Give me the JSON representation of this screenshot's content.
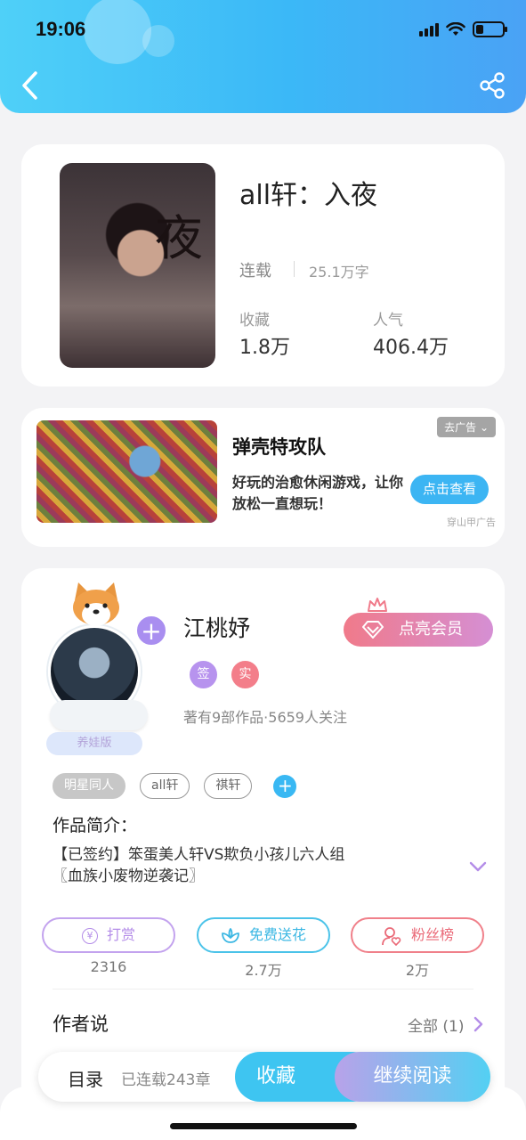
{
  "status_bar": {
    "time": "19:06",
    "battery_percent": 20
  },
  "header": {
    "back_icon": "chevron-left-icon",
    "share_icon": "share-icon"
  },
  "book": {
    "title": "all轩：入夜",
    "status": "连载",
    "word_count": "25.1万字",
    "favorites_label": "收藏",
    "favorites_value": "1.8万",
    "popularity_label": "人气",
    "popularity_value": "406.4万",
    "cover_glyph": "夜"
  },
  "ad": {
    "title": "弹壳特攻队",
    "description": "好玩的治愈休闲游戏，让你放松一直想玩！",
    "tag": "去广告 ⌄",
    "cta": "点击查看",
    "source": "穿山甲广告"
  },
  "author": {
    "name": "江桃妤",
    "vip_button": "点亮会员",
    "badge_sign": "签",
    "badge_real": "实",
    "stats": "著有9部作品·5659人关注",
    "avatar_plus": "+",
    "avatar_edition": "养娃版",
    "tags": [
      "明星同人",
      "all轩",
      "祺轩"
    ],
    "tag_add": "+",
    "intro_heading": "作品简介：",
    "intro_line1": "【已签约】笨蛋美人轩VS欺负小孩儿六人组",
    "intro_line2": "〖血族小废物逆袭记〗",
    "actions": [
      {
        "label": "打赏",
        "count": "2316",
        "color": "#b48de8"
      },
      {
        "label": "免费送花",
        "count": "2.7万",
        "color": "#4bc3e9"
      },
      {
        "label": "粉丝榜",
        "count": "2万",
        "color": "#f0808a"
      }
    ],
    "author_says_heading": "作者说",
    "author_says_all": "全部 (1)"
  },
  "bottom_bar": {
    "toc_label": "目录",
    "chapter_count": "已连载243章",
    "favorite_button": "收藏",
    "continue_button": "继续阅读"
  }
}
